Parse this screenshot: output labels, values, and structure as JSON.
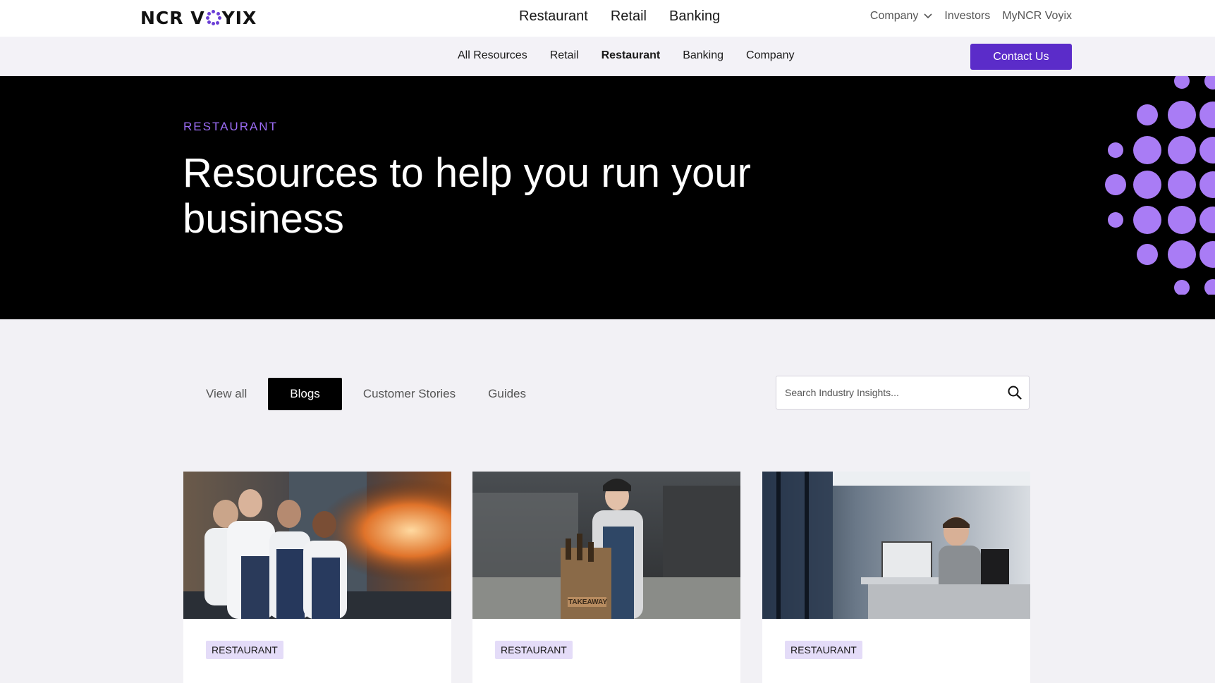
{
  "header": {
    "logo_text_left": "NCR V",
    "logo_text_right": "YIX",
    "main_nav": [
      "Restaurant",
      "Retail",
      "Banking"
    ],
    "company_label": "Company",
    "investors_label": "Investors",
    "mynrc_label": "MyNCR Voyix"
  },
  "subnav": {
    "items": [
      {
        "label": "All Resources"
      },
      {
        "label": "Retail"
      },
      {
        "label": "Restaurant"
      },
      {
        "label": "Banking"
      },
      {
        "label": "Company"
      }
    ],
    "contact_label": "Contact Us"
  },
  "hero": {
    "eyebrow": "RESTAURANT",
    "title": "Resources to help you run your business"
  },
  "filters": {
    "items": [
      "View all",
      "Blogs",
      "Customer Stories",
      "Guides"
    ],
    "active": "Blogs"
  },
  "search": {
    "placeholder": "Search Industry Insights..."
  },
  "cards": [
    {
      "badge": "RESTAURANT"
    },
    {
      "badge": "RESTAURANT"
    },
    {
      "badge": "RESTAURANT"
    }
  ],
  "colors": {
    "accent": "#5b2cc9",
    "dots": "#a97cf5",
    "hero_bg": "#000000"
  },
  "icons": {
    "search": "search-icon",
    "chevron": "chevron-down-icon"
  }
}
